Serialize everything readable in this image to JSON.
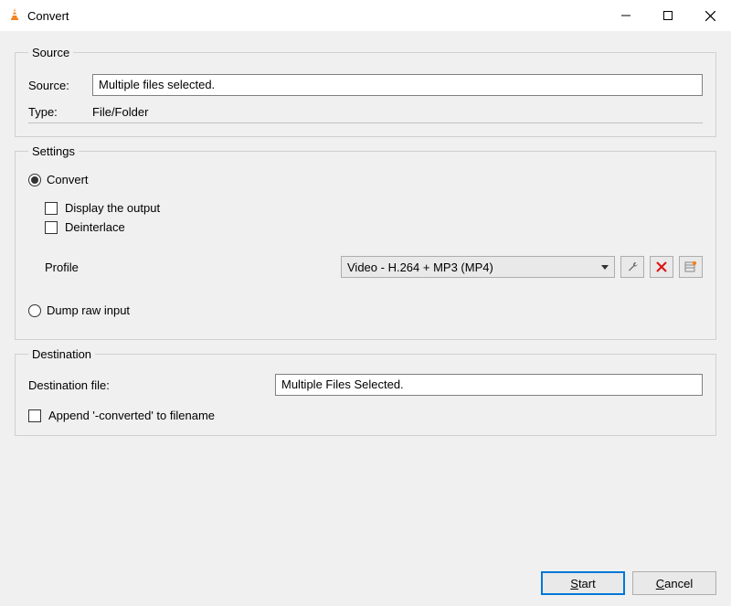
{
  "window": {
    "title": "Convert"
  },
  "source": {
    "legend": "Source",
    "source_label": "Source:",
    "source_value": "Multiple files selected.",
    "type_label": "Type:",
    "type_value": "File/Folder"
  },
  "settings": {
    "legend": "Settings",
    "convert_label": "Convert",
    "convert_checked": true,
    "display_output_label": "Display the output",
    "display_output_checked": false,
    "deinterlace_label": "Deinterlace",
    "deinterlace_checked": false,
    "profile_label": "Profile",
    "profile_selected": "Video - H.264 + MP3 (MP4)",
    "dump_label": "Dump raw input",
    "dump_checked": false
  },
  "destination": {
    "legend": "Destination",
    "file_label": "Destination file:",
    "file_value": "Multiple Files Selected.",
    "append_label": "Append '-converted' to filename",
    "append_checked": false
  },
  "footer": {
    "start_accel": "S",
    "start_rest": "tart",
    "cancel_accel": "C",
    "cancel_rest": "ancel"
  }
}
